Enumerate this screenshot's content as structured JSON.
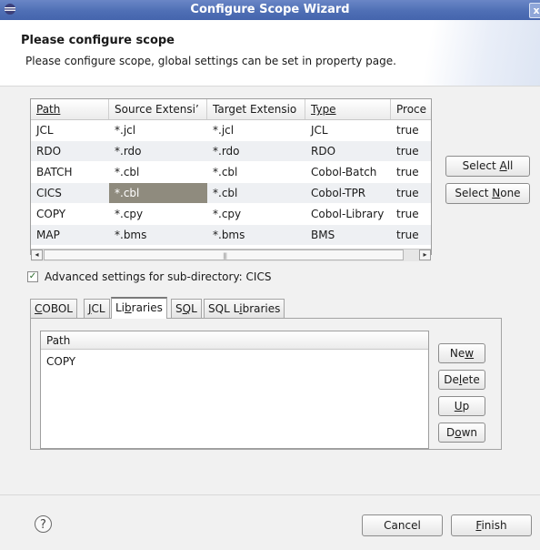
{
  "window": {
    "title": "Configure Scope Wizard",
    "close_glyph": "x"
  },
  "header": {
    "title": "Please configure scope",
    "description": "Please configure scope, global settings can be set in property page."
  },
  "scope_table": {
    "columns": [
      "Path",
      "Source Extensi’",
      "Target Extensio",
      "Type",
      "Proce"
    ],
    "rows": [
      {
        "path": "JCL",
        "source": "*.jcl",
        "target": "*.jcl",
        "type": "JCL",
        "process": "true",
        "alt": false,
        "selected": false
      },
      {
        "path": "RDO",
        "source": "*.rdo",
        "target": "*.rdo",
        "type": "RDO",
        "process": "true",
        "alt": true,
        "selected": false
      },
      {
        "path": "BATCH",
        "source": "*.cbl",
        "target": "*.cbl",
        "type": "Cobol-Batch",
        "process": "true",
        "alt": false,
        "selected": false
      },
      {
        "path": "CICS",
        "source": "*.cbl",
        "target": "*.cbl",
        "type": "Cobol-TPR",
        "process": "true",
        "alt": true,
        "selected": true
      },
      {
        "path": "COPY",
        "source": "*.cpy",
        "target": "*.cpy",
        "type": "Cobol-Library",
        "process": "true",
        "alt": false,
        "selected": false
      },
      {
        "path": "MAP",
        "source": "*.bms",
        "target": "*.bms",
        "type": "BMS",
        "process": "true",
        "alt": true,
        "selected": false
      }
    ],
    "scroll_left": "◂",
    "scroll_right": "▸",
    "scroll_grip": "|||"
  },
  "buttons": {
    "select_all": {
      "pre": "Select ",
      "mn": "A",
      "post": "ll"
    },
    "select_none": {
      "pre": "Select ",
      "mn": "N",
      "post": "one"
    },
    "new": {
      "pre": "Ne",
      "mn": "w",
      "post": ""
    },
    "delete": {
      "pre": "De",
      "mn": "l",
      "post": "ete"
    },
    "up": {
      "pre": "",
      "mn": "U",
      "post": "p"
    },
    "down": {
      "pre": "D",
      "mn": "o",
      "post": "wn"
    },
    "cancel": "Cancel",
    "finish": {
      "pre": "",
      "mn": "F",
      "post": "inish"
    }
  },
  "advanced": {
    "checked": true,
    "check_glyph": "✓",
    "label": "Advanced settings for sub-directory: CICS"
  },
  "tabs": [
    {
      "pre": "",
      "mn": "C",
      "post": "OBOL",
      "active": false
    },
    {
      "pre": "",
      "mn": "J",
      "post": "CL",
      "active": false
    },
    {
      "pre": "Li",
      "mn": "b",
      "post": "raries",
      "active": true
    },
    {
      "pre": "S",
      "mn": "Q",
      "post": "L",
      "active": false
    },
    {
      "pre": "SQL L",
      "mn": "i",
      "post": "braries",
      "active": false
    }
  ],
  "libraries": {
    "header": "Path",
    "items": [
      "COPY"
    ]
  },
  "help_glyph": "?"
}
